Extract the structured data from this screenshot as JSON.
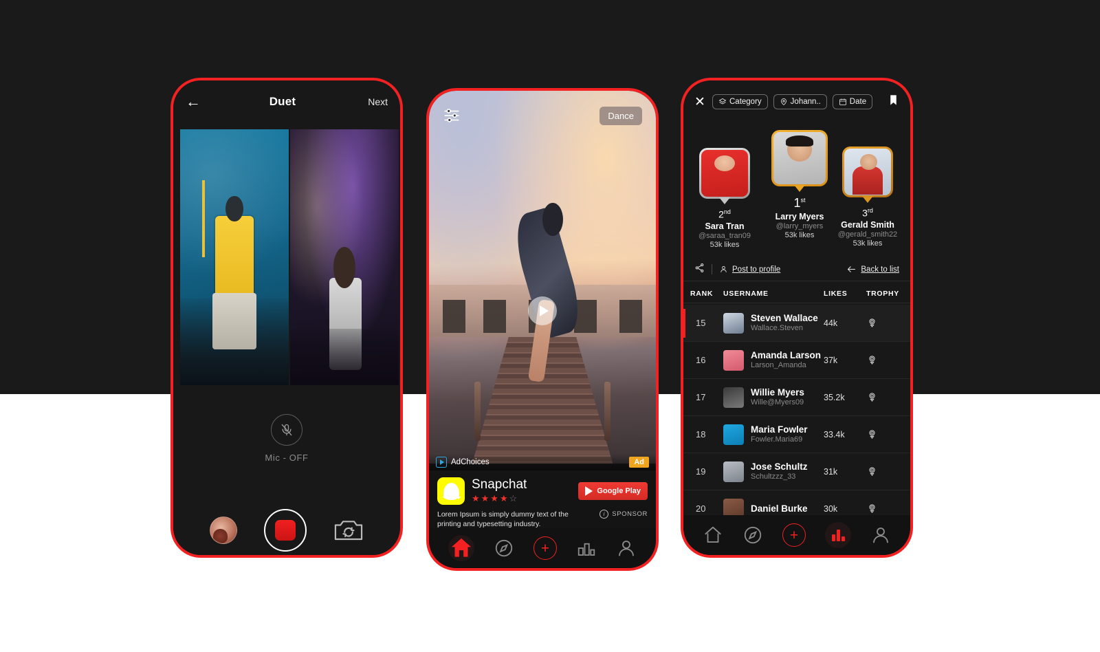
{
  "canvas": {
    "background_top": "#1a1a1a",
    "background_bottom": "#ffffff",
    "frame_color": "#f32121"
  },
  "phone1": {
    "back_icon": "arrow-left-icon",
    "title": "Duet",
    "next_label": "Next",
    "mic_label": "Mic - OFF",
    "mic_icon": "mic-off-icon",
    "record_label": "record-button",
    "flip_icon": "camera-flip-icon",
    "gallery_thumb": "gallery-thumbnail"
  },
  "phone2": {
    "sliders_icon": "sliders-icon",
    "category_badge": "Dance",
    "play_icon": "play-icon",
    "adchoices_label": "AdChoices",
    "ad_badge": "Ad",
    "ad": {
      "app_name": "Snapchat",
      "rating": 4,
      "rating_max": 5,
      "cta_label": "Google Play",
      "description": "Lorem Ipsum is simply dummy text of the printing and typesetting industry.",
      "sponsor_label": "SPONSOR",
      "icon": "snapchat-ghost-icon",
      "badge_color": "#f0a51e",
      "cta_color": "#ef3b34",
      "icon_bg": "#FFFC00"
    },
    "nav": [
      {
        "name": "home",
        "icon": "home-icon",
        "active": true
      },
      {
        "name": "discover",
        "icon": "compass-icon",
        "active": false
      },
      {
        "name": "create",
        "icon": "plus-circle-icon",
        "active": false
      },
      {
        "name": "leaderboard",
        "icon": "bar-chart-icon",
        "active": false
      },
      {
        "name": "profile",
        "icon": "user-icon",
        "active": false
      }
    ]
  },
  "phone3": {
    "close_icon": "close-icon",
    "bookmark_icon": "bookmark-icon",
    "filters": [
      {
        "label": "Category",
        "icon": "layers-icon"
      },
      {
        "label": "Johann..",
        "icon": "location-pin-icon"
      },
      {
        "label": "Date",
        "icon": "calendar-icon"
      }
    ],
    "podium": [
      {
        "rank": "2",
        "suffix": "nd",
        "name": "Sara Tran",
        "handle": "@saraa_tran09",
        "likes": "53k likes"
      },
      {
        "rank": "1",
        "suffix": "st",
        "name": "Larry Myers",
        "handle": "@larry_myers",
        "likes": "53k likes"
      },
      {
        "rank": "3",
        "suffix": "rd",
        "name": "Gerald Smith",
        "handle": "@gerald_smith22",
        "likes": "53k likes"
      }
    ],
    "actions": {
      "share_icon": "share-icon",
      "post_to_profile": "Post to profile",
      "post_icon": "user-icon",
      "back_to_list": "Back to list",
      "back_icon": "arrow-left-icon"
    },
    "table": {
      "headers": {
        "rank": "RANK",
        "username": "USERNAME",
        "likes": "LIKES",
        "trophy": "TROPHY"
      },
      "rows": [
        {
          "rank": "15",
          "name": "Steven Wallace",
          "handle": "Wallace.Steven",
          "likes": "44k",
          "trophy": "trophy-icon",
          "active": true
        },
        {
          "rank": "16",
          "name": "Amanda Larson",
          "handle": "Larson_Amanda",
          "likes": "37k",
          "trophy": "trophy-icon",
          "active": false
        },
        {
          "rank": "17",
          "name": "Willie Myers",
          "handle": "Wille@Myers09",
          "likes": "35.2k",
          "trophy": "trophy-icon",
          "active": false
        },
        {
          "rank": "18",
          "name": "Maria Fowler",
          "handle": "Fowler.Maria69",
          "likes": "33.4k",
          "trophy": "trophy-icon",
          "active": false
        },
        {
          "rank": "19",
          "name": "Jose Schultz",
          "handle": "Schultzzz_33",
          "likes": "31k",
          "trophy": "trophy-icon",
          "active": false
        },
        {
          "rank": "20",
          "name": "Daniel Burke",
          "handle": "",
          "likes": "30k",
          "trophy": "trophy-icon",
          "active": false
        }
      ]
    },
    "nav": [
      {
        "name": "home",
        "icon": "home-icon",
        "active": false
      },
      {
        "name": "discover",
        "icon": "compass-icon",
        "active": false
      },
      {
        "name": "create",
        "icon": "plus-circle-icon",
        "active": false
      },
      {
        "name": "leaderboard",
        "icon": "bar-chart-icon",
        "active": true
      },
      {
        "name": "profile",
        "icon": "user-icon",
        "active": false
      }
    ]
  }
}
